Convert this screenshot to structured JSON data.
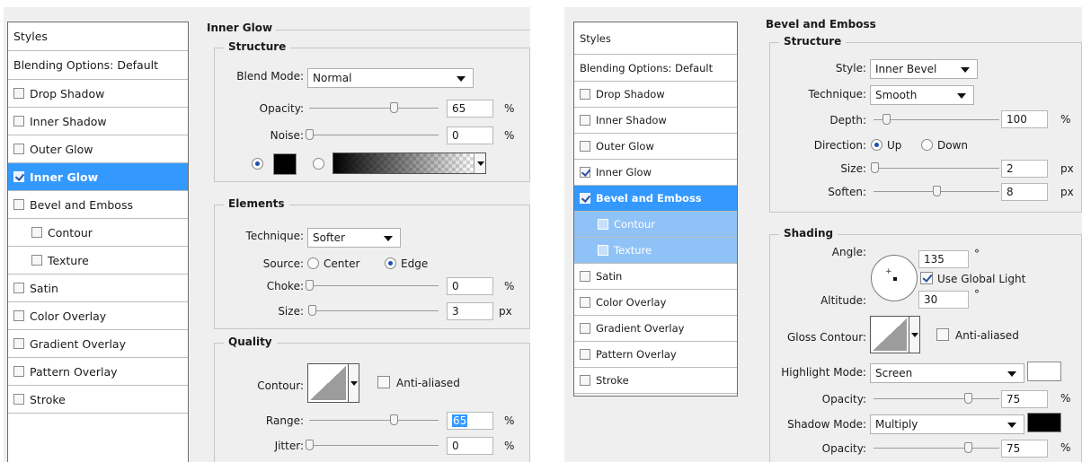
{
  "left": {
    "styles_header": "Styles",
    "blending_options": "Blending Options: Default",
    "items": [
      {
        "label": "Drop Shadow",
        "checked": false,
        "sub": false,
        "selected": false
      },
      {
        "label": "Inner Shadow",
        "checked": false,
        "sub": false,
        "selected": false
      },
      {
        "label": "Outer Glow",
        "checked": false,
        "sub": false,
        "selected": false
      },
      {
        "label": "Inner Glow",
        "checked": true,
        "sub": false,
        "selected": true
      },
      {
        "label": "Bevel and Emboss",
        "checked": false,
        "sub": false,
        "selected": false
      },
      {
        "label": "Contour",
        "checked": false,
        "sub": true,
        "selected": false
      },
      {
        "label": "Texture",
        "checked": false,
        "sub": true,
        "selected": false
      },
      {
        "label": "Satin",
        "checked": false,
        "sub": false,
        "selected": false
      },
      {
        "label": "Color Overlay",
        "checked": false,
        "sub": false,
        "selected": false
      },
      {
        "label": "Gradient Overlay",
        "checked": false,
        "sub": false,
        "selected": false
      },
      {
        "label": "Pattern Overlay",
        "checked": false,
        "sub": false,
        "selected": false
      },
      {
        "label": "Stroke",
        "checked": false,
        "sub": false,
        "selected": false
      }
    ],
    "panel_title": "Inner Glow",
    "structure": {
      "title": "Structure",
      "blend_mode_label": "Blend Mode:",
      "blend_mode_value": "Normal",
      "opacity_label": "Opacity:",
      "opacity_value": "65",
      "opacity_unit": "%",
      "opacity_level": 0.65,
      "noise_label": "Noise:",
      "noise_value": "0",
      "noise_unit": "%",
      "noise_level": 0.0,
      "swatch_color": "#000000"
    },
    "elements": {
      "title": "Elements",
      "technique_label": "Technique:",
      "technique_value": "Softer",
      "source_label": "Source:",
      "source_center": "Center",
      "source_edge": "Edge",
      "choke_label": "Choke:",
      "choke_value": "0",
      "choke_unit": "%",
      "choke_level": 0.0,
      "size_label": "Size:",
      "size_value": "3",
      "size_unit": "px",
      "size_level": 0.02
    },
    "quality": {
      "title": "Quality",
      "contour_label": "Contour:",
      "antialiased_label": "Anti-aliased",
      "range_label": "Range:",
      "range_value": "65",
      "range_unit": "%",
      "range_level": 0.65,
      "jitter_label": "Jitter:",
      "jitter_value": "0",
      "jitter_unit": "%",
      "jitter_level": 0.0
    }
  },
  "right": {
    "styles_header": "Styles",
    "blending_options": "Blending Options: Default",
    "items": [
      {
        "label": "Drop Shadow",
        "checked": false,
        "sub": false,
        "selected": false
      },
      {
        "label": "Inner Shadow",
        "checked": false,
        "sub": false,
        "selected": false
      },
      {
        "label": "Outer Glow",
        "checked": false,
        "sub": false,
        "selected": false
      },
      {
        "label": "Inner Glow",
        "checked": true,
        "sub": false,
        "selected": false
      },
      {
        "label": "Bevel and Emboss",
        "checked": true,
        "sub": false,
        "selected": true
      },
      {
        "label": "Contour",
        "checked": false,
        "sub": true,
        "selected": false,
        "selected_sub": true
      },
      {
        "label": "Texture",
        "checked": false,
        "sub": true,
        "selected": false,
        "selected_sub": true
      },
      {
        "label": "Satin",
        "checked": false,
        "sub": false,
        "selected": false
      },
      {
        "label": "Color Overlay",
        "checked": false,
        "sub": false,
        "selected": false
      },
      {
        "label": "Gradient Overlay",
        "checked": false,
        "sub": false,
        "selected": false
      },
      {
        "label": "Pattern Overlay",
        "checked": false,
        "sub": false,
        "selected": false
      },
      {
        "label": "Stroke",
        "checked": false,
        "sub": false,
        "selected": false
      }
    ],
    "panel_title": "Bevel and Emboss",
    "structure": {
      "title": "Structure",
      "style_label": "Style:",
      "style_value": "Inner Bevel",
      "technique_label": "Technique:",
      "technique_value": "Smooth",
      "depth_label": "Depth:",
      "depth_value": "100",
      "depth_unit": "%",
      "depth_level": 0.1,
      "direction_label": "Direction:",
      "direction_up": "Up",
      "direction_down": "Down",
      "size_label": "Size:",
      "size_value": "2",
      "size_unit": "px",
      "size_level": 0.01,
      "soften_label": "Soften:",
      "soften_value": "8",
      "soften_unit": "px",
      "soften_level": 0.5
    },
    "shading": {
      "title": "Shading",
      "angle_label": "Angle:",
      "angle_value": "135",
      "angle_unit": "°",
      "global_light_label": "Use Global Light",
      "altitude_label": "Altitude:",
      "altitude_value": "30",
      "altitude_unit": "°",
      "gloss_contour_label": "Gloss Contour:",
      "antialiased_label": "Anti-aliased",
      "highlight_mode_label": "Highlight Mode:",
      "highlight_mode_value": "Screen",
      "highlight_color": "#ffffff",
      "highlight_opacity_label": "Opacity:",
      "highlight_opacity_value": "75",
      "highlight_opacity_unit": "%",
      "highlight_opacity_level": 0.75,
      "shadow_mode_label": "Shadow Mode:",
      "shadow_mode_value": "Multiply",
      "shadow_color": "#000000",
      "shadow_opacity_label": "Opacity:",
      "shadow_opacity_value": "75",
      "shadow_opacity_unit": "%",
      "shadow_opacity_level": 0.75
    }
  }
}
